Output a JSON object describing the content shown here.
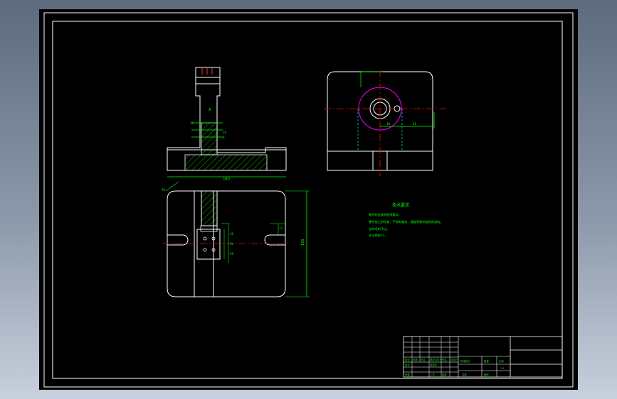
{
  "drawing": {
    "colors": {
      "background": "#000000",
      "outline": "#ffffff",
      "dimension": "#00ff00",
      "centerline": "#ff0000",
      "hatch": "#00ff00",
      "hidden": "#00ffff",
      "circle_accent": "#ff00ff"
    },
    "tech_requirements": {
      "title": "技术要求",
      "lines": [
        "零件制造按照图纸要求。",
        "零件加工前检查，不得有裂纹、磕碰等影响使用的缺陷。",
        "去除毛刺飞边。",
        "未注倒角C1。"
      ]
    },
    "dimensions": {
      "front_width": "180",
      "plan_height": "160",
      "top_offset": "41",
      "top_center": "18",
      "front_small_a": "12",
      "front_small_b": "10",
      "front_small_c": "8",
      "plan_small_a": "10",
      "plan_small_b": "24",
      "plan_small_c": "20",
      "plan_slot": "12",
      "section_label": "A",
      "leader_label": "R5"
    },
    "title_block": {
      "labels": [
        "标记",
        "处数",
        "分区",
        "更改文件号",
        "签名",
        "年月日",
        "设计",
        "标准化",
        "阶段标记",
        "重量",
        "比例",
        "审核",
        "工艺",
        "批准",
        "共张",
        "第张"
      ],
      "scale": "1:1"
    }
  }
}
